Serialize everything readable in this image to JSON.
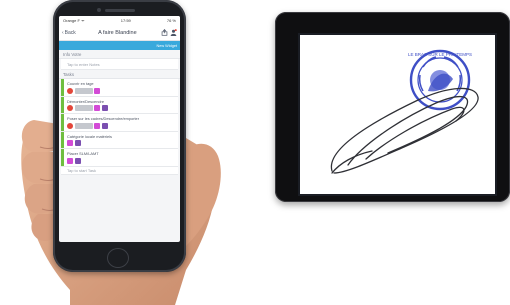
{
  "phone": {
    "status": {
      "carrier": "Orange F ᯤ",
      "time": "17:59",
      "battery": "76 %"
    },
    "header": {
      "back_label": "Back",
      "title": "A faire Blandine"
    },
    "action_button": "New Widget",
    "section_description": "Info Votre",
    "description_placeholder": "Tap to enter Notes",
    "section_tasks": "Tasks",
    "tasks": [
      {
        "name": "Couvrir en tage",
        "icons": [
          "red",
          "grey",
          "pink"
        ]
      },
      {
        "name": "Démonter/Descendre",
        "icons": [
          "red",
          "grey",
          "pink",
          "purple"
        ]
      },
      {
        "name": "Poser sur les cadres/Descendre/emporter",
        "icons": [
          "red",
          "grey",
          "pink",
          "purple"
        ]
      },
      {
        "name": "Catégorie locale matériels",
        "icons": [
          "pink",
          "purple"
        ]
      },
      {
        "name": "Placer SLM/LAMT",
        "icons": [
          "pink",
          "purple"
        ]
      }
    ],
    "footer_placeholder": "Tap to start Task"
  },
  "tablet": {
    "stamp_text": "LE BRAS SUR LE PRINTEMPS"
  },
  "colors": {
    "accent_blue": "#39a9dc",
    "task_green": "#6fbe3f",
    "stamp_blue": "#3f4fc6"
  }
}
